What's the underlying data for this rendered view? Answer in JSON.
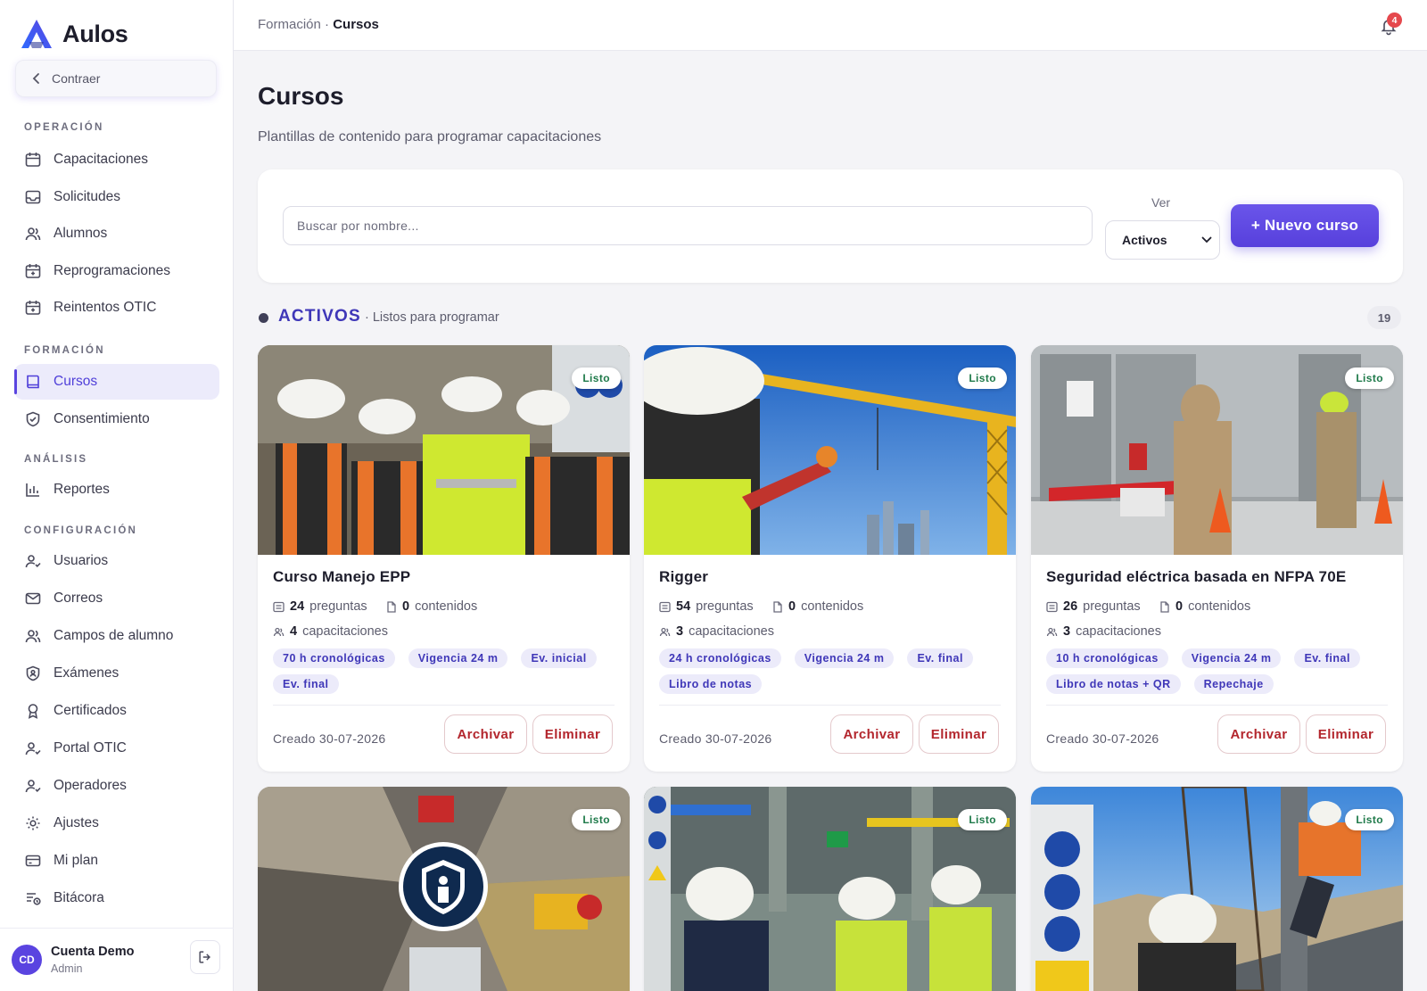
{
  "brand": {
    "name": "Aulos",
    "accent": "#5a44e0"
  },
  "sidebar": {
    "collapse_label": "Contraer",
    "sections": [
      {
        "title": "OPERACIÓN",
        "items": [
          "Capacitaciones",
          "Solicitudes",
          "Alumnos",
          "Reprogramaciones",
          "Reintentos OTIC"
        ]
      },
      {
        "title": "FORMACIÓN",
        "items": [
          "Cursos",
          "Consentimiento"
        ]
      },
      {
        "title": "ANÁLISIS",
        "items": [
          "Reportes"
        ]
      },
      {
        "title": "CONFIGURACIÓN",
        "items": [
          "Usuarios",
          "Correos",
          "Campos de alumno",
          "Exámenes",
          "Certificados",
          "Portal OTIC",
          "Operadores",
          "Ajustes",
          "Mi plan",
          "Bitácora"
        ]
      }
    ],
    "active_item": "Cursos",
    "account": {
      "initials": "CD",
      "name": "Cuenta Demo",
      "role": "Admin"
    }
  },
  "topbar": {
    "breadcrumb_parent": "Formación",
    "breadcrumb_separator": "·",
    "breadcrumb_current": "Cursos",
    "notification_count": "4"
  },
  "main": {
    "title": "Cursos",
    "subtitle": "Plantillas de contenido para programar capacitaciones",
    "search_placeholder": "Buscar por nombre...",
    "view_label": "Ver",
    "view_selected": "Activos",
    "new_button": "+ Nuevo curso",
    "section": {
      "name": "ACTIVOS",
      "description": "· Listos para programar",
      "count": "19"
    }
  },
  "courses": [
    {
      "status": "Listo",
      "title": "Curso Manejo EPP",
      "questions": "24",
      "questions_label": "preguntas",
      "contents": "0",
      "contents_label": "contenidos",
      "trainings": "4",
      "trainings_label": "capacitaciones",
      "tags": [
        "70 h cronológicas",
        "Vigencia 24 m",
        "Ev. inicial",
        "Ev. final"
      ],
      "created": "Creado 30-07-2026",
      "archive_label": "Archivar",
      "delete_label": "Eliminar"
    },
    {
      "status": "Listo",
      "title": "Rigger",
      "questions": "54",
      "questions_label": "preguntas",
      "contents": "0",
      "contents_label": "contenidos",
      "trainings": "3",
      "trainings_label": "capacitaciones",
      "tags": [
        "24 h cronológicas",
        "Vigencia 24 m",
        "Ev. final",
        "Libro de notas"
      ],
      "created": "Creado 30-07-2026",
      "archive_label": "Archivar",
      "delete_label": "Eliminar"
    },
    {
      "status": "Listo",
      "title": "Seguridad eléctrica basada en NFPA 70E",
      "questions": "26",
      "questions_label": "preguntas",
      "contents": "0",
      "contents_label": "contenidos",
      "trainings": "3",
      "trainings_label": "capacitaciones",
      "tags": [
        "10 h cronológicas",
        "Vigencia 24 m",
        "Ev. final",
        "Libro de notas + QR",
        "Repechaje"
      ],
      "created": "Creado 30-07-2026",
      "archive_label": "Archivar",
      "delete_label": "Eliminar"
    },
    {
      "status": "Listo"
    },
    {
      "status": "Listo"
    },
    {
      "status": "Listo"
    }
  ]
}
